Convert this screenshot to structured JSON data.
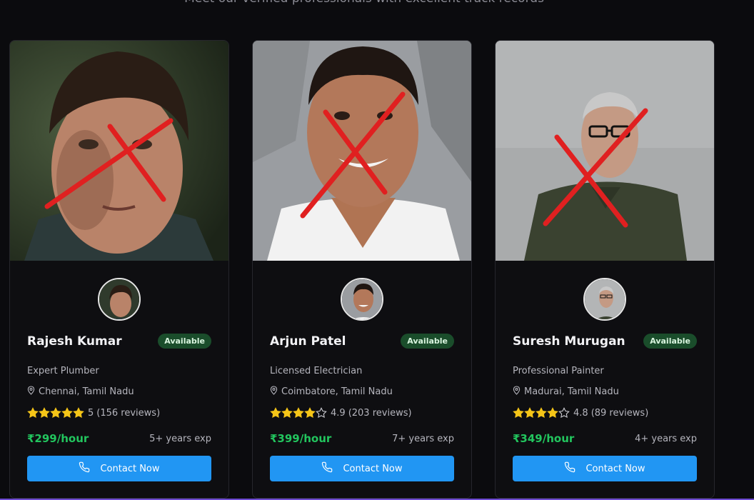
{
  "header": {
    "subtitle": "Meet our verified professionals with excellent track records"
  },
  "colors": {
    "accent": "#2196f3",
    "price": "#22c55e",
    "badge_bg": "#1a4d2b",
    "star": "#f5c518"
  },
  "cards": [
    {
      "name": "Rajesh Kumar",
      "badge": "Available",
      "role": "Expert Plumber",
      "location": "Chennai, Tamil Nadu",
      "rating_value": "5",
      "reviews": "(156 reviews)",
      "stars_filled": 5,
      "price": "₹299/hour",
      "experience": "5+ years exp",
      "cta": "Contact Now"
    },
    {
      "name": "Arjun Patel",
      "badge": "Available",
      "role": "Licensed Electrician",
      "location": "Coimbatore, Tamil Nadu",
      "rating_value": "4.9",
      "reviews": "(203 reviews)",
      "stars_filled": 4,
      "price": "₹399/hour",
      "experience": "7+ years exp",
      "cta": "Contact Now"
    },
    {
      "name": "Suresh Murugan",
      "badge": "Available",
      "role": "Professional Painter",
      "location": "Madurai, Tamil Nadu",
      "rating_value": "4.8",
      "reviews": "(89 reviews)",
      "stars_filled": 4,
      "price": "₹349/hour",
      "experience": "4+ years exp",
      "cta": "Contact Now"
    }
  ]
}
